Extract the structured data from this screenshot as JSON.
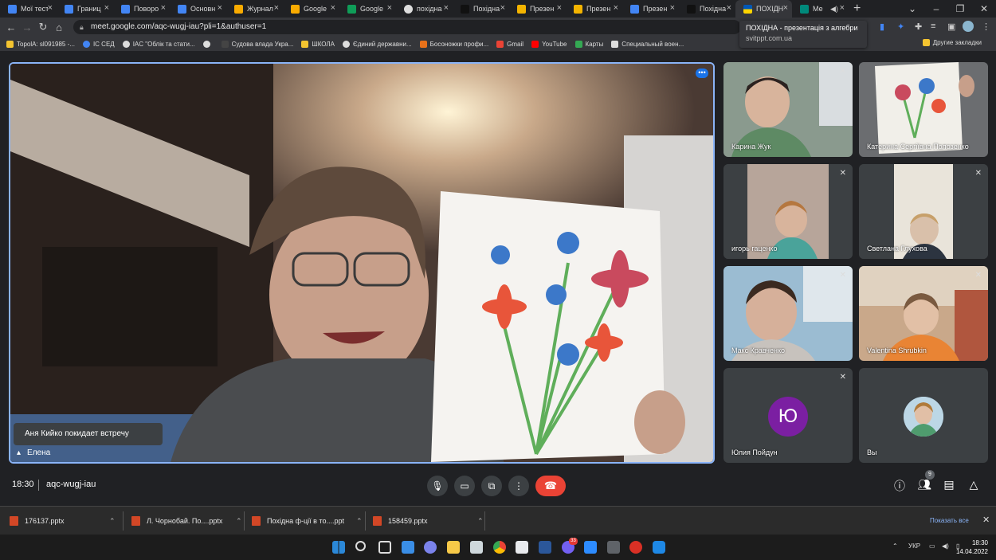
{
  "browser": {
    "tabs": [
      {
        "label": "Мої тест",
        "color": "#4285f4"
      },
      {
        "label": "Границ",
        "color": "#4285f4"
      },
      {
        "label": "Поворо",
        "color": "#4285f4"
      },
      {
        "label": "Основн",
        "color": "#4285f4"
      },
      {
        "label": "Журнал",
        "color": "#f9ab00"
      },
      {
        "label": "Google",
        "color": "#f9ab00"
      },
      {
        "label": "Google",
        "color": "#0f9d58"
      },
      {
        "label": "похідна",
        "color": "#dddddd"
      },
      {
        "label": "Похідна",
        "color": "#111111"
      },
      {
        "label": "Презен",
        "color": "#f4b400"
      },
      {
        "label": "Презен",
        "color": "#f4b400"
      },
      {
        "label": "Презен",
        "color": "#4285f4"
      },
      {
        "label": "Похідна",
        "color": "#111111"
      },
      {
        "label": "ПОХІДН",
        "color": "#ffd500"
      },
      {
        "label": "Ме",
        "color": "#00897b"
      }
    ],
    "new_tab": "+",
    "url": "meet.google.com/aqc-wugj-iau?pli=1&authuser=1",
    "tooltip": {
      "title": "ПОХІДНА - презентація з алгебри",
      "domain": "svitppt.com.ua"
    },
    "bookmarks": [
      {
        "label": "TopolA: sl091985 -...",
        "color": "#f4c430"
      },
      {
        "label": "IC СЕД",
        "color": "#4285f4"
      },
      {
        "label": "IAC \"Облік та стати...",
        "color": "#dddddd"
      },
      {
        "label": "",
        "color": "#dddddd"
      },
      {
        "label": "Судова влада Укра...",
        "color": "#444444"
      },
      {
        "label": "ШКОЛА",
        "color": "#f4c430"
      },
      {
        "label": "Єдиний державни...",
        "color": "#dddddd"
      },
      {
        "label": "Босоножки профи...",
        "color": "#e8711a"
      },
      {
        "label": "Gmail",
        "color": "#ea4335"
      },
      {
        "label": "YouTube",
        "color": "#ff0000"
      },
      {
        "label": "Карты",
        "color": "#34a853"
      },
      {
        "label": "Специальный воен...",
        "color": "#dddddd"
      }
    ],
    "other_bookmarks": "Другие закладки"
  },
  "meet": {
    "toast": "Аня Кийко покидает встречу",
    "presenter_name": "Елена",
    "more_label": "•••",
    "participants": [
      {
        "name": "Карина Жук",
        "muted": true
      },
      {
        "name": "Катерина Сергіївна Полозенко",
        "muted": false
      },
      {
        "name": "игорь гаценко",
        "muted": true
      },
      {
        "name": "Светлана Глухова",
        "muted": true
      },
      {
        "name": "Макс Кравченко",
        "muted": true
      },
      {
        "name": "Valentina Shrubkin",
        "muted": true
      },
      {
        "name": "Юлия Пойдун",
        "muted": true,
        "initial": "Ю"
      },
      {
        "name": "Вы",
        "muted": false
      }
    ],
    "time": "18:30",
    "meeting_code": "aqc-wugj-iau",
    "participant_count": "9"
  },
  "downloads": {
    "items": [
      {
        "label": "176137.pptx"
      },
      {
        "label": "Л. Чорнобай. По....pptx"
      },
      {
        "label": "Похідна ф-ції в то....ppt"
      },
      {
        "label": "158459.pptx"
      }
    ],
    "show_all": "Показать все"
  },
  "taskbar": {
    "lang": "УКР",
    "time": "18:30",
    "date": "14.04.2022",
    "notification_badge": "33"
  }
}
